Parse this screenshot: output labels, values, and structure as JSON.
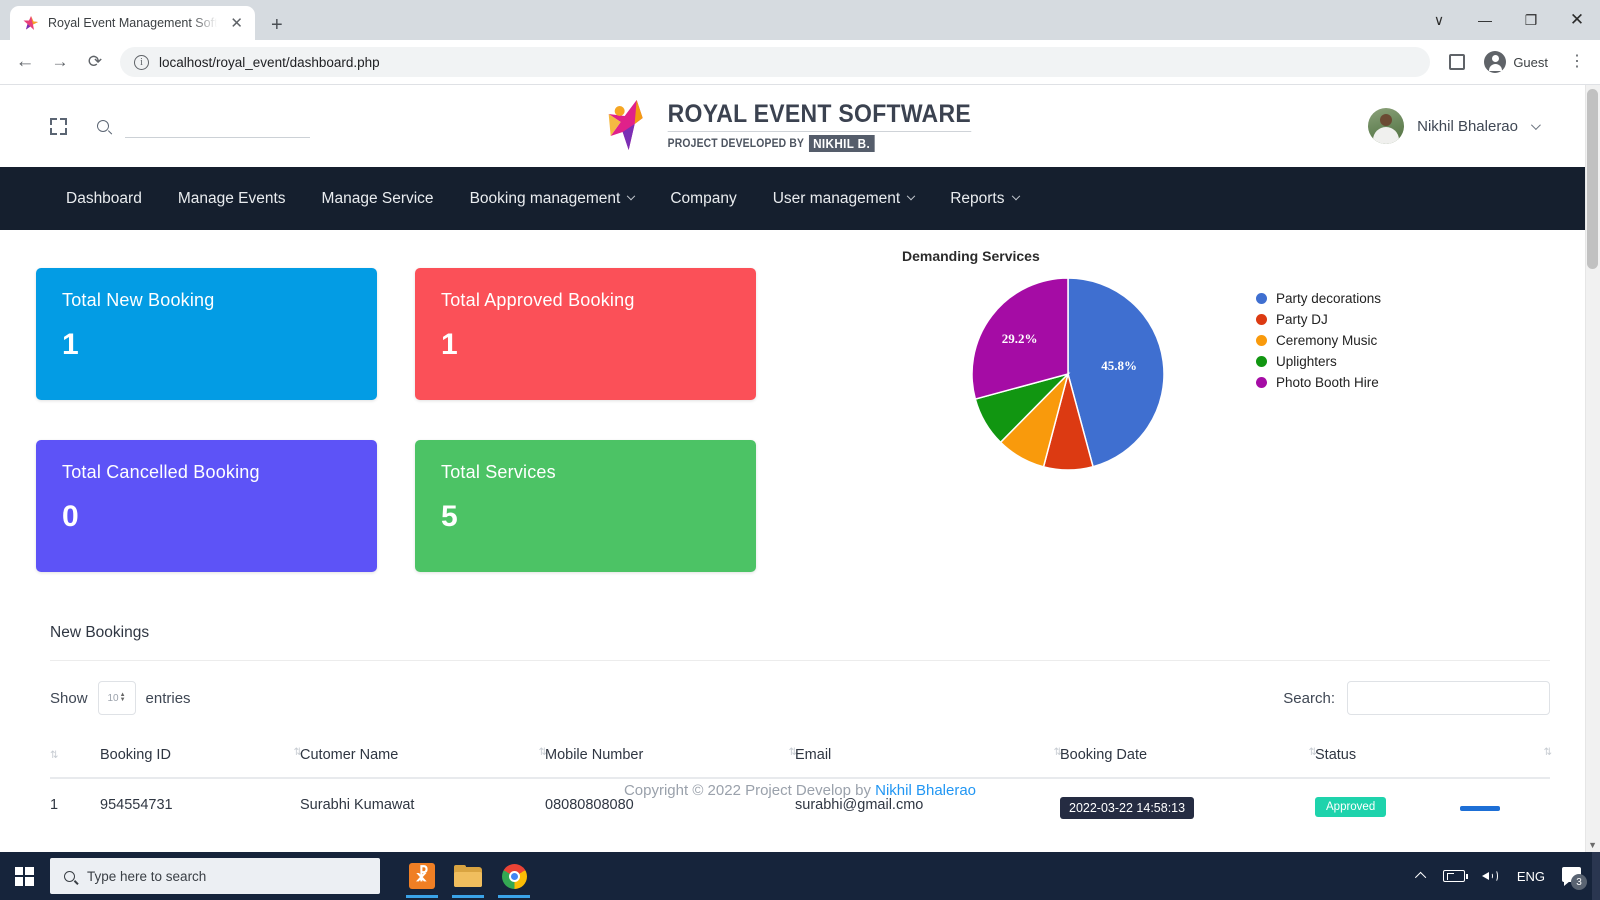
{
  "browser": {
    "tab_title": "Royal Event Management Softwa",
    "tab_close_glyph": "✕",
    "new_tab_glyph": "+",
    "back_glyph": "←",
    "forward_glyph": "→",
    "reload_glyph": "⟳",
    "info_glyph": "i",
    "url": "localhost/royal_event/dashboard.php",
    "profile_label": "Guest",
    "kebab_glyph": "⋮",
    "win_dropdown": "∨",
    "win_minimize": "—",
    "win_maximize": "❐",
    "win_close": "✕"
  },
  "topbar": {
    "search_placeholder": "",
    "search_value": "",
    "user_name": "Nikhil Bhalerao"
  },
  "brand": {
    "line1": "ROYAL EVENT SOFTWARE",
    "line2_prefix": "PROJECT DEVELOPED BY",
    "line2_chip": "NIKHIL B."
  },
  "nav": {
    "items": [
      {
        "label": "Dashboard",
        "caret": false
      },
      {
        "label": "Manage Events",
        "caret": false
      },
      {
        "label": "Manage Service",
        "caret": false
      },
      {
        "label": "Booking management",
        "caret": true
      },
      {
        "label": "Company",
        "caret": false
      },
      {
        "label": "User management",
        "caret": true
      },
      {
        "label": "Reports",
        "caret": true
      }
    ]
  },
  "cards": [
    {
      "title": "Total New Booking",
      "value": "1",
      "color": "#039ce4"
    },
    {
      "title": "Total Approved Booking",
      "value": "1",
      "color": "#fb5058"
    },
    {
      "title": "Total Cancelled Booking",
      "value": "0",
      "color": "#5d53f7"
    },
    {
      "title": "Total Services",
      "value": "5",
      "color": "#4cc365"
    }
  ],
  "chart_data": {
    "type": "pie",
    "title": "Demanding Services",
    "categories": [
      "Party decorations",
      "Party DJ",
      "Ceremony Music",
      "Uplighters",
      "Photo Booth Hire"
    ],
    "values": [
      45.8,
      8.3,
      8.3,
      8.4,
      29.2
    ],
    "value_unit": "%",
    "colors": [
      "#3f6fd0",
      "#dc3a12",
      "#f99a0c",
      "#119611",
      "#a50ca5"
    ],
    "visible_labels": [
      {
        "category": "Party decorations",
        "text": "45.8%"
      },
      {
        "category": "Photo Booth Hire",
        "text": "29.2%"
      }
    ],
    "legend_position": "right",
    "grid": false
  },
  "table_section": {
    "heading": "New Bookings",
    "show_label": "Show",
    "entries_label": "entries",
    "entries_value": "10",
    "search_label": "Search:",
    "search_value": "",
    "search_placeholder": "",
    "sort_glyph": "⇅",
    "columns": [
      "",
      "Booking ID",
      "Cutomer Name",
      "Mobile Number",
      "Email",
      "Booking Date",
      "Status"
    ],
    "rows": [
      {
        "index": "1",
        "booking_id": "954554731",
        "customer_name": "Surabhi Kumawat",
        "mobile": "08080808080",
        "email": "surabhi@gmail.cmo",
        "booking_date": "2022-03-22 14:58:13",
        "status": "Approved"
      }
    ]
  },
  "footer": {
    "text": "Copyright © 2022 Project Develop by ",
    "link": "Nikhil Bhalerao"
  },
  "taskbar": {
    "search_placeholder": "Type here to search",
    "language": "ENG",
    "notification_count": "3",
    "apps": [
      "xampp-icon",
      "file-explorer-icon",
      "chrome-icon"
    ]
  }
}
